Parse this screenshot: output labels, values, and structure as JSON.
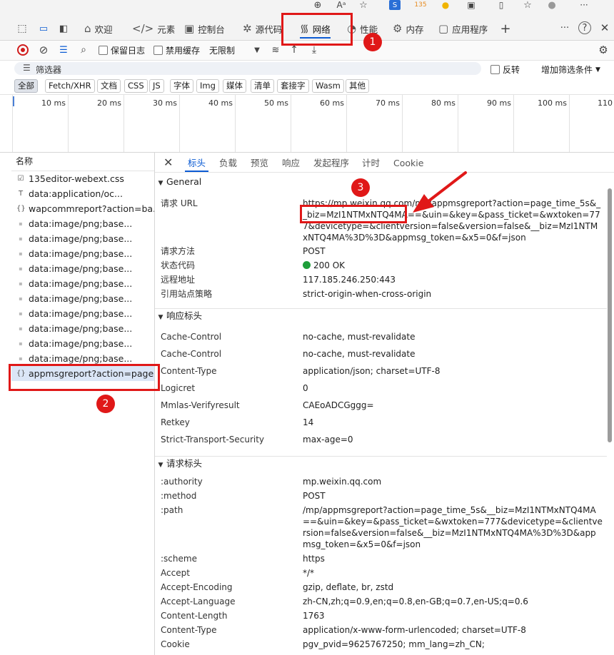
{
  "tabs": [
    {
      "id": "welcome",
      "label": "欢迎",
      "icon": "home-icon"
    },
    {
      "id": "elements",
      "label": "元素",
      "icon": "code-icon"
    },
    {
      "id": "console",
      "label": "控制台",
      "icon": "console-icon"
    },
    {
      "id": "sources",
      "label": "源代码",
      "icon": "bug-icon"
    },
    {
      "id": "network",
      "label": "网络",
      "icon": "wifi-icon"
    },
    {
      "id": "performance",
      "label": "性能",
      "icon": "gauge-icon"
    },
    {
      "id": "memory",
      "label": "内存",
      "icon": "gear-icon"
    },
    {
      "id": "application",
      "label": "应用程序",
      "icon": "app-icon"
    }
  ],
  "toolbar": {
    "preserve_log": "保留日志",
    "disable_cache": "禁用缓存",
    "throttle": "无限制"
  },
  "filter": {
    "placeholder": "筛选器",
    "invert": "反转",
    "more_filters": "增加筛选条件"
  },
  "types": [
    "全部",
    "Fetch/XHR",
    "文档",
    "CSS",
    "JS",
    "字体",
    "Img",
    "媒体",
    "清单",
    "套接字",
    "Wasm",
    "其他"
  ],
  "timeline_ticks": [
    "10 ms",
    "20 ms",
    "30 ms",
    "40 ms",
    "50 ms",
    "60 ms",
    "70 ms",
    "80 ms",
    "90 ms",
    "100 ms",
    "110"
  ],
  "list": {
    "header": "名称",
    "items": [
      {
        "name": "135editor-webext.css",
        "icon": "☑"
      },
      {
        "name": "data:application/oc...",
        "icon": "T"
      },
      {
        "name": "wapcommreport?action=ba...",
        "icon": "{}"
      },
      {
        "name": "data:image/png;base...",
        "icon": "▪"
      },
      {
        "name": "data:image/png;base...",
        "icon": "▪"
      },
      {
        "name": "data:image/png;base...",
        "icon": "▪"
      },
      {
        "name": "data:image/png;base...",
        "icon": "▪"
      },
      {
        "name": "data:image/png;base...",
        "icon": "▪"
      },
      {
        "name": "data:image/png;base...",
        "icon": "▪"
      },
      {
        "name": "data:image/png;base...",
        "icon": "▪"
      },
      {
        "name": "data:image/png;base...",
        "icon": "▪"
      },
      {
        "name": "data:image/png;base...",
        "icon": "▪"
      },
      {
        "name": "data:image/png;base...",
        "icon": "▪"
      },
      {
        "name": "appmsgreport?action=page...",
        "icon": "{}"
      }
    ]
  },
  "detail_tabs": [
    "标头",
    "负载",
    "预览",
    "响应",
    "发起程序",
    "计时",
    "Cookie"
  ],
  "general": {
    "title": "General",
    "rows": [
      {
        "k": "请求 URL",
        "v": "https://mp.weixin.qq.com/mp/appmsgreport?action=page_time_5s&__biz=MzI1NTMxNTQ4MA==&uin=&key=&pass_ticket=&wxtoken=777&devicetype=&clientversion=false&version=false&__biz=MzI1NTMxNTQ4MA%3D%3D&appmsg_token=&x5=0&f=json"
      },
      {
        "k": "请求方法",
        "v": "POST"
      },
      {
        "k": "状态代码",
        "v": "200 OK"
      },
      {
        "k": "远程地址",
        "v": "117.185.246.250:443"
      },
      {
        "k": "引用站点策略",
        "v": "strict-origin-when-cross-origin"
      }
    ]
  },
  "response_headers": {
    "title": "响应标头",
    "rows": [
      {
        "k": "Cache-Control",
        "v": "no-cache, must-revalidate"
      },
      {
        "k": "Cache-Control",
        "v": "no-cache, must-revalidate"
      },
      {
        "k": "Content-Type",
        "v": "application/json; charset=UTF-8"
      },
      {
        "k": "Logicret",
        "v": "0"
      },
      {
        "k": "Mmlas-Verifyresult",
        "v": "CAEoADCGggg="
      },
      {
        "k": "Retkey",
        "v": "14"
      },
      {
        "k": "Strict-Transport-Security",
        "v": "max-age=0"
      }
    ]
  },
  "request_headers": {
    "title": "请求标头",
    "rows": [
      {
        "k": ":authority",
        "v": "mp.weixin.qq.com"
      },
      {
        "k": ":method",
        "v": "POST"
      },
      {
        "k": ":path",
        "v": "/mp/appmsgreport?action=page_time_5s&__biz=MzI1NTMxNTQ4MA==&uin=&key=&pass_ticket=&wxtoken=777&devicetype=&clientversion=false&version=false&__biz=MzI1NTMxNTQ4MA%3D%3D&appmsg_token=&x5=0&f=json"
      },
      {
        "k": ":scheme",
        "v": "https"
      },
      {
        "k": "Accept",
        "v": "*/*"
      },
      {
        "k": "Accept-Encoding",
        "v": "gzip, deflate, br, zstd"
      },
      {
        "k": "Accept-Language",
        "v": "zh-CN,zh;q=0.9,en;q=0.8,en-GB;q=0.7,en-US;q=0.6"
      },
      {
        "k": "Content-Length",
        "v": "1763"
      },
      {
        "k": "Content-Type",
        "v": "application/x-www-form-urlencoded; charset=UTF-8"
      },
      {
        "k": "Cookie",
        "v": "pgv_pvid=9625767250; mm_lang=zh_CN;"
      }
    ]
  },
  "annotations": [
    "1",
    "2",
    "3"
  ],
  "colors": {
    "accent": "#0b5bd3",
    "annotation": "#e01818",
    "status_ok": "#1e9e3a"
  }
}
